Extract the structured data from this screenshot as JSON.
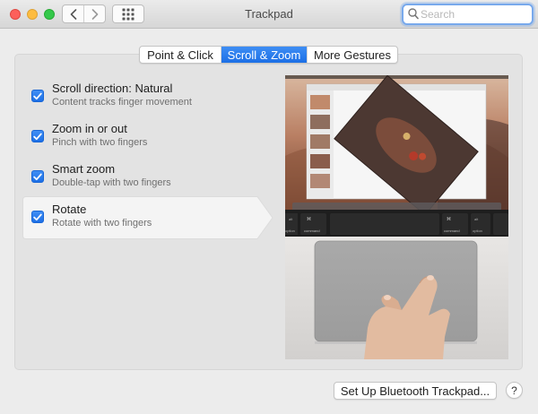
{
  "window": {
    "title": "Trackpad",
    "icons": [
      "close-icon",
      "minimize-icon",
      "zoom-icon",
      "back-icon",
      "forward-icon",
      "show-all-grid-icon"
    ]
  },
  "search": {
    "value": "",
    "placeholder": "Search",
    "icon": "search-icon"
  },
  "tabs": [
    {
      "label": "Point & Click",
      "selected": false
    },
    {
      "label": "Scroll & Zoom",
      "selected": true
    },
    {
      "label": "More Gestures",
      "selected": false
    }
  ],
  "options": [
    {
      "title": "Scroll direction: Natural",
      "subtitle": "Content tracks finger movement",
      "checked": true
    },
    {
      "title": "Zoom in or out",
      "subtitle": "Pinch with two fingers",
      "checked": true
    },
    {
      "title": "Smart zoom",
      "subtitle": "Double-tap with two fingers",
      "checked": true
    },
    {
      "title": "Rotate",
      "subtitle": "Rotate with two fingers",
      "checked": true,
      "selected": true
    }
  ],
  "preview": {
    "keys": {
      "left_symbol": "⌘",
      "left_label": "command",
      "right_symbol": "⌘",
      "right_label": "command",
      "left_alt": "alt",
      "right_alt": "alt",
      "left_option": "option",
      "right_option": "option"
    }
  },
  "footer": {
    "bluetooth_button": "Set Up Bluetooth Trackpad...",
    "help_button": "?"
  },
  "colors": {
    "accent": "#1c6fe6",
    "window_bg": "#ececec",
    "panel_bg": "#e3e3e3"
  }
}
